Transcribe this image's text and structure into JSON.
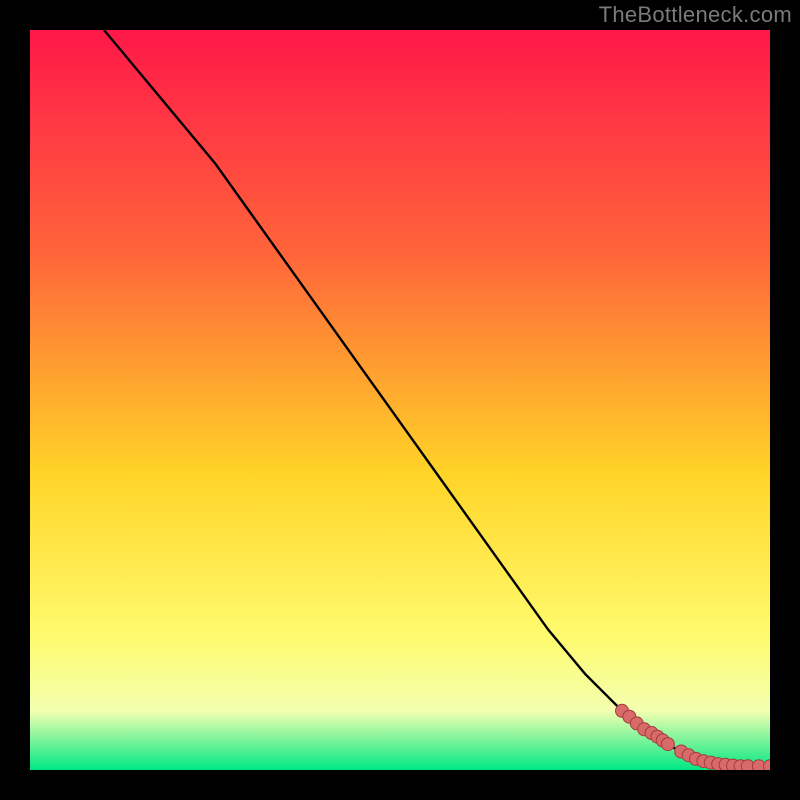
{
  "watermark": "TheBottleneck.com",
  "colors": {
    "frame_bg": "#000000",
    "grad_top": "#ff1849",
    "grad_mid_upper": "#ff643a",
    "grad_mid": "#ffd427",
    "grad_mid_lower": "#fffb6e",
    "grad_lower": "#f3ffb0",
    "grad_bottom": "#00e884",
    "curve": "#000000",
    "marker_fill": "#d86a6a",
    "marker_stroke": "#a33c3c"
  },
  "chart_data": {
    "type": "line",
    "title": "",
    "xlabel": "",
    "ylabel": "",
    "xlim": [
      0,
      100
    ],
    "ylim": [
      0,
      100
    ],
    "series": [
      {
        "name": "curve",
        "x": [
          10,
          15,
          20,
          25,
          30,
          35,
          40,
          45,
          50,
          55,
          60,
          65,
          70,
          75,
          80,
          82,
          84,
          86,
          88,
          90,
          92,
          94,
          96,
          98,
          100
        ],
        "y": [
          100,
          94,
          88,
          82,
          75,
          68,
          61,
          54,
          47,
          40,
          33,
          26,
          19,
          13,
          8,
          6,
          5,
          3.5,
          2.5,
          1.5,
          1,
          0.7,
          0.5,
          0.5,
          0.5
        ]
      }
    ],
    "markers": {
      "name": "highlight-points",
      "x": [
        80,
        81,
        82,
        83,
        84,
        84.8,
        85.5,
        86.2,
        88,
        89,
        90,
        91,
        92,
        93,
        94,
        95,
        96,
        97,
        98.5,
        100
      ],
      "y": [
        8,
        7.2,
        6.3,
        5.5,
        5,
        4.5,
        4,
        3.5,
        2.5,
        2,
        1.5,
        1.2,
        1,
        0.8,
        0.7,
        0.6,
        0.5,
        0.5,
        0.5,
        0.5
      ]
    }
  }
}
